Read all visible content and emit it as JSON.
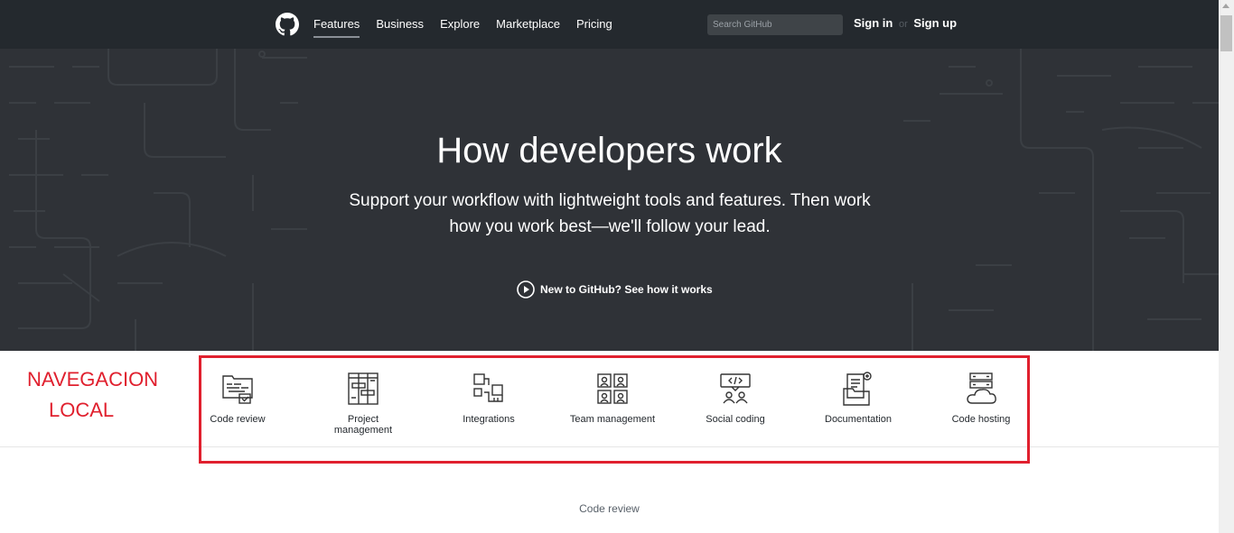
{
  "header": {
    "nav": [
      "Features",
      "Business",
      "Explore",
      "Marketplace",
      "Pricing"
    ],
    "search_placeholder": "Search GitHub",
    "sign_in": "Sign in",
    "or": "or",
    "sign_up": "Sign up"
  },
  "hero": {
    "title": "How developers work",
    "subtitle_line1": "Support your workflow with lightweight tools and features. Then work",
    "subtitle_line2": "how you work best—we'll follow your lead.",
    "video_link": "New to GitHub? See how it works"
  },
  "features_nav": [
    {
      "label": "Code review",
      "icon": "code-review-icon"
    },
    {
      "label": "Project management",
      "icon": "project-management-icon"
    },
    {
      "label": "Integrations",
      "icon": "integrations-icon"
    },
    {
      "label": "Team management",
      "icon": "team-management-icon"
    },
    {
      "label": "Social coding",
      "icon": "social-coding-icon"
    },
    {
      "label": "Documentation",
      "icon": "documentation-icon"
    },
    {
      "label": "Code hosting",
      "icon": "code-hosting-icon"
    }
  ],
  "annotation": {
    "line1": "NAVEGACION",
    "line2": "LOCAL",
    "color": "#e0202e"
  },
  "section": {
    "label": "Code review"
  }
}
